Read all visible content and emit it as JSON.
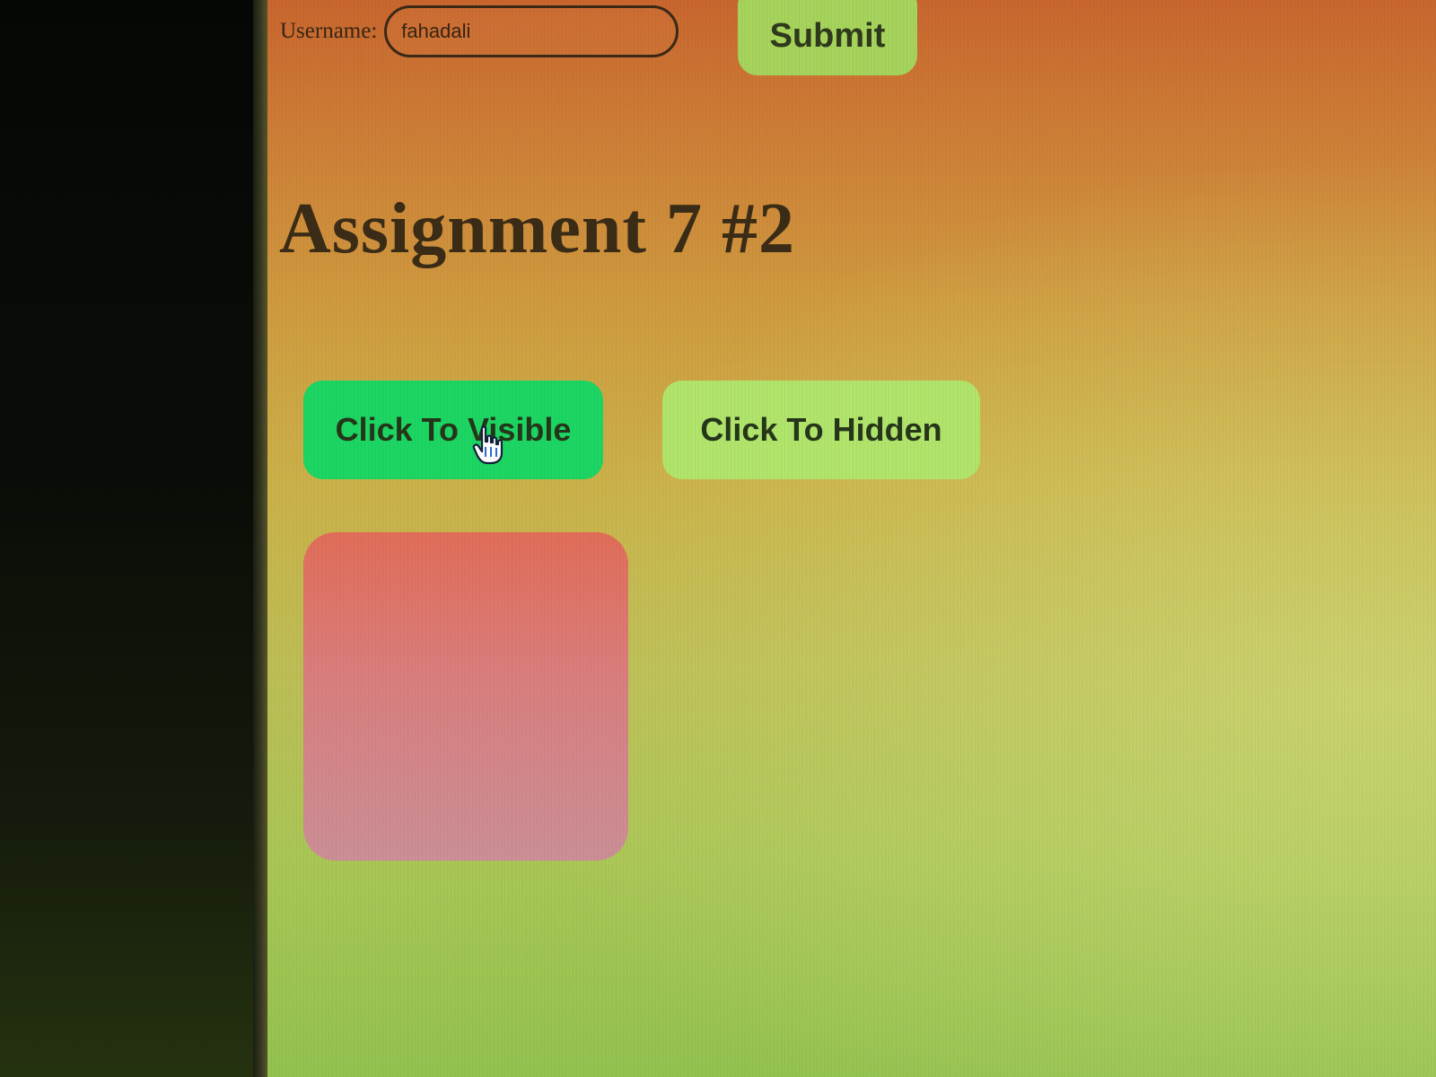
{
  "form": {
    "username_label": "Username:",
    "username_value": "fahadali",
    "submit_label": "Submit"
  },
  "heading": {
    "title": "Assignment 7 #2"
  },
  "controls": {
    "visible_label": "Click To Visible",
    "hidden_label": "Click To Hidden"
  },
  "colors": {
    "visible_button": "#1cd562",
    "hidden_button": "#b0e46b",
    "submit_button": "#a5d35b",
    "toggle_box": "#e16d58",
    "background_top": "#c8662e",
    "background_bottom": "#93c24f"
  },
  "icons": {
    "cursor": "hand-pointer-icon"
  }
}
